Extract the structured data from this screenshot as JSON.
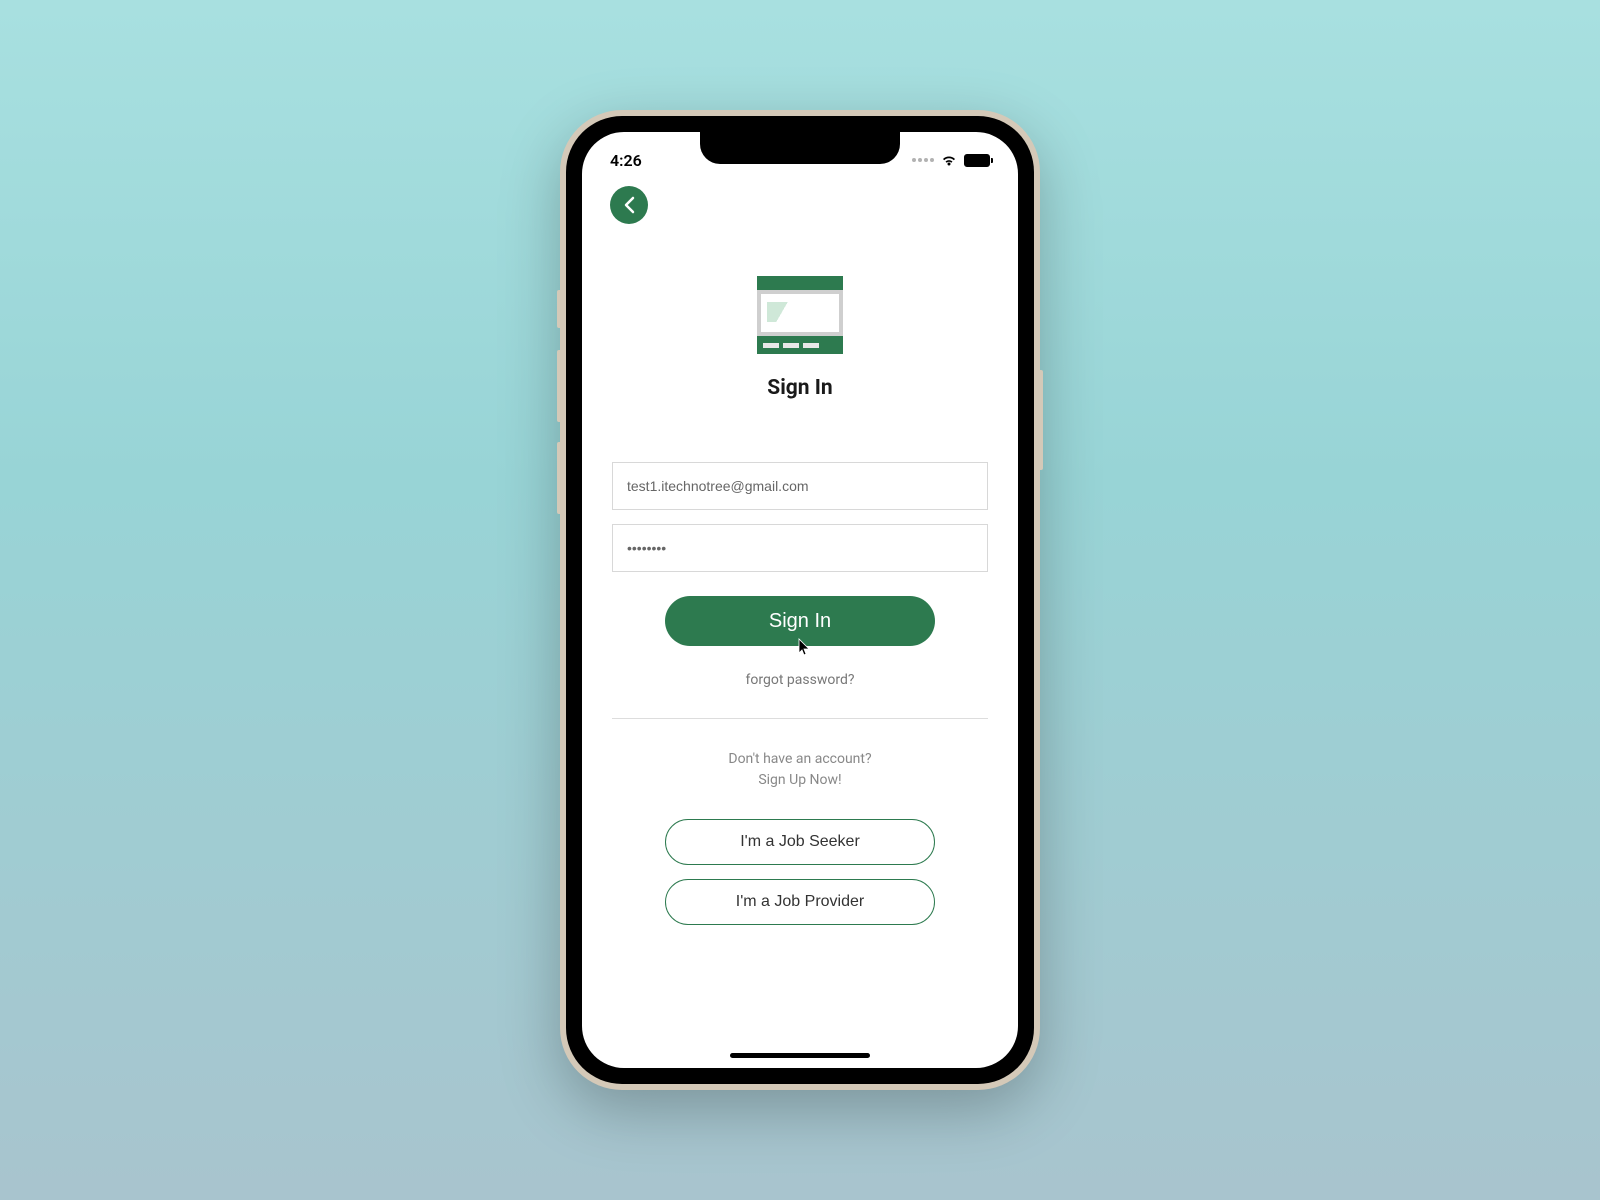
{
  "status_bar": {
    "time": "4:26"
  },
  "page": {
    "title": "Sign In"
  },
  "form": {
    "email_value": "test1.itechnotree@gmail.com",
    "password_value": "••••••••",
    "signin_label": "Sign In",
    "forgot_label": "forgot password?"
  },
  "signup": {
    "prompt_line1": "Don't have an account?",
    "prompt_line2": "Sign Up Now!",
    "seeker_label": "I'm a Job Seeker",
    "provider_label": "I'm a Job Provider"
  }
}
